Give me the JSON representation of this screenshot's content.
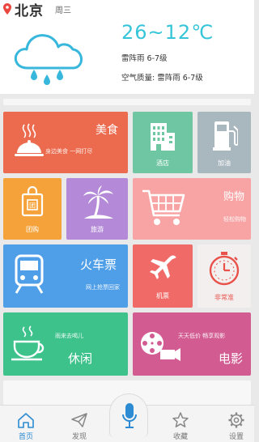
{
  "weather": {
    "city": "北京",
    "weekday": "周三",
    "temperature": "26~12℃",
    "condition": "雷阵雨 6-7级",
    "air_quality": "空气质量: 雷阵雨 6-7级",
    "icons": {
      "location": "map-pin-icon",
      "weather": "rain-cloud-icon"
    },
    "temp_color": "#35c4d8"
  },
  "tiles": {
    "food": {
      "title": "美食",
      "subtitle": "身边美食 一网打尽",
      "color": "#ec6a4d",
      "icon": "dish-cover-icon"
    },
    "hotel": {
      "label": "酒店",
      "color": "#6ec6a2",
      "icon": "building-icon"
    },
    "gas": {
      "label": "加油",
      "color": "#a9b7be",
      "icon": "fuel-pump-icon"
    },
    "group": {
      "label": "团购",
      "color": "#f5a23a",
      "icon": "shopping-bag-icon"
    },
    "travel": {
      "label": "旅游",
      "color": "#b48ad8",
      "icon": "palm-tree-icon"
    },
    "shopping": {
      "title": "购物",
      "subtitle": "轻松购物",
      "color": "#f8a4a4",
      "icon": "shopping-cart-icon"
    },
    "train": {
      "title": "火车票",
      "subtitle": "网上抢票回家",
      "color": "#4f9ee8",
      "icon": "train-icon"
    },
    "flight": {
      "label": "机票",
      "color": "#f06a68",
      "icon": "airplane-icon"
    },
    "delay": {
      "label": "非常准",
      "color": "#e8524a",
      "icon": "stopwatch-icon"
    },
    "leisure": {
      "title": "休闲",
      "subtitle": "雨来去喝儿",
      "color": "#3ec28c",
      "icon": "coffee-cup-icon"
    },
    "movie": {
      "title": "电影",
      "subtitle": "天天低价  畅享观影",
      "color": "#d25c92",
      "icon": "film-reel-icon"
    }
  },
  "tabbar": {
    "home": {
      "label": "首页",
      "icon": "home-icon",
      "active": true
    },
    "discover": {
      "label": "发现",
      "icon": "paper-plane-icon"
    },
    "voice": {
      "icon": "microphone-icon"
    },
    "favorites": {
      "label": "收藏",
      "icon": "star-icon"
    },
    "settings": {
      "label": "设置",
      "icon": "gear-icon"
    },
    "active_color": "#2c8bd2"
  }
}
